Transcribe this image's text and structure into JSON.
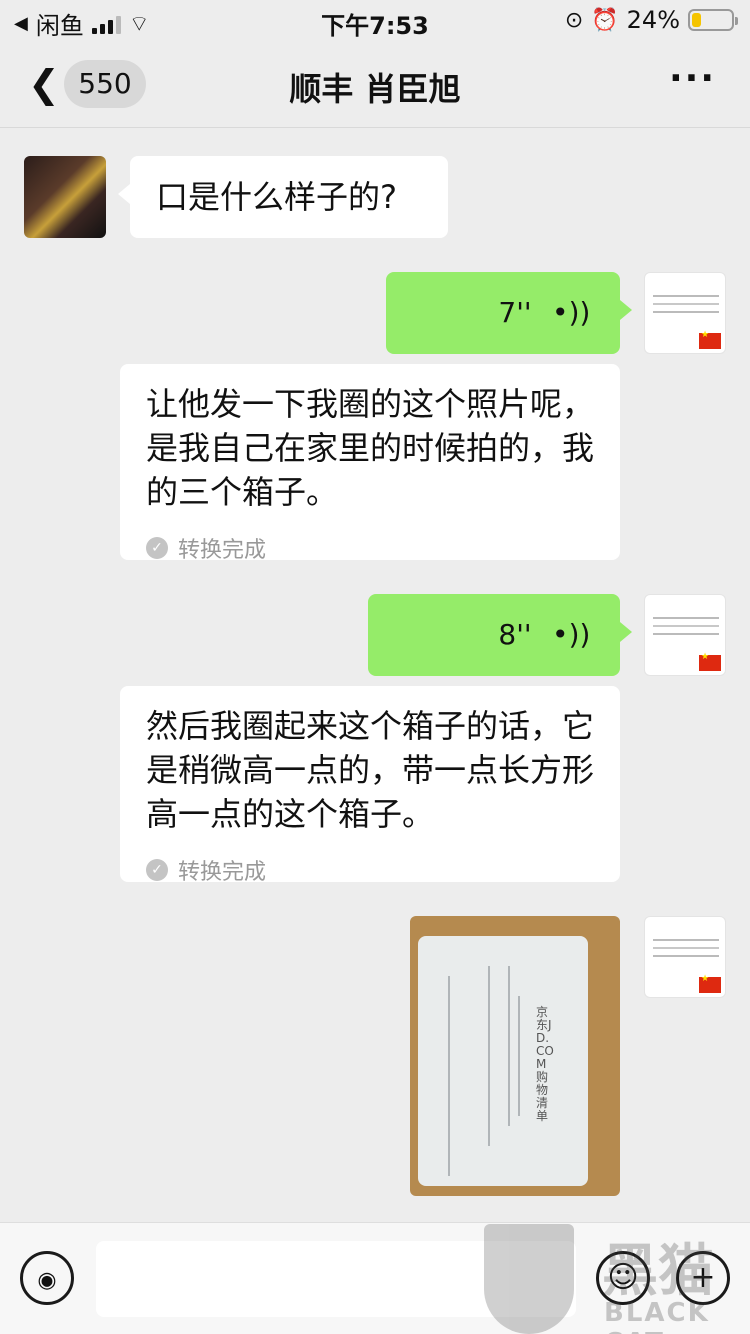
{
  "status_bar": {
    "back_app": "闲鱼",
    "time": "下午7:53",
    "battery": "24%",
    "battery_level": 0.24
  },
  "nav": {
    "unread_count": "550",
    "title": "顺丰 肖臣旭",
    "more": "···"
  },
  "messages": {
    "m1_text": "口是什么样子的?",
    "v1_duration": "7''",
    "t1_text": "让他发一下我圈的这个照片呢，是我自己在家里的时候拍的，我的三个箱子。",
    "t1_status": "转换完成",
    "v2_duration": "8''",
    "t2_text": "然后我圈起来这个箱子的话，它是稍微高一点的，带一点长方形高一点的这个箱子。",
    "t2_status": "转换完成",
    "photo_label": "京东JD.COM购物清单"
  },
  "watermark": {
    "big": "黑猫",
    "text": "BLACK CAT"
  },
  "colors": {
    "background": "#ededed",
    "green_bubble": "#95ec69",
    "white_bubble": "#ffffff",
    "battery_fill": "#f5c400"
  }
}
